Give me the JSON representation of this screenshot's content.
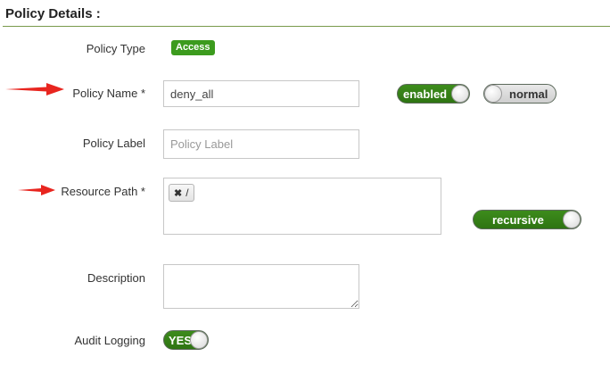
{
  "section": {
    "title": "Policy Details :"
  },
  "policy_type": {
    "label": "Policy Type",
    "badge": "Access"
  },
  "policy_name": {
    "label": "Policy Name *",
    "value": "deny_all",
    "enabled_toggle": "enabled",
    "normal_toggle": "normal"
  },
  "policy_label": {
    "label": "Policy Label",
    "placeholder": "Policy Label"
  },
  "resource_path": {
    "label": "Resource Path *",
    "tags": [
      {
        "remove_icon": "✖",
        "text": "/"
      }
    ],
    "recursive_toggle": "recursive"
  },
  "description": {
    "label": "Description",
    "value": ""
  },
  "audit_logging": {
    "label": "Audit Logging",
    "toggle": "YES"
  },
  "colors": {
    "accent_green": "#3c9b1e",
    "arrow_red": "#e8251f",
    "rule": "#7a9a4c"
  }
}
